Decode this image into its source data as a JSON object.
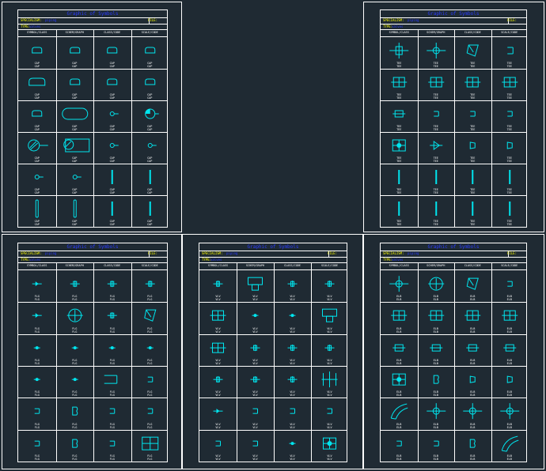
{
  "drawing": {
    "title": "Graphic of Symbols",
    "spec_label": "SPECIALISM:",
    "spec_value": "piping",
    "file_label": "FILE:",
    "type_label": "TYPE:",
    "type_value": "valves",
    "headers": [
      "SYMBOL/CLASS",
      "SCHEM/GRAPH",
      "CLASS/CODE",
      "SCALE/CODE"
    ],
    "colors": {
      "symbol": "#00e5ee",
      "title": "#2a3cff",
      "label": "#ffff00",
      "frame": "#ffffff",
      "background": "#1f2a33"
    }
  },
  "sheets": [
    {
      "name": "sheet-1",
      "captions": [
        [
          "CAP\nCAP",
          "CAP\nCAP",
          "CAP\nCAP",
          "CAP\nCAP"
        ],
        [
          "CAP\nCAP",
          "CAP\nCAP",
          "CAP\nCAP",
          "CAP\nCAP"
        ],
        [
          "CAP\nCAP",
          "CAP\nCAP",
          "CAP\nCAP",
          "CAP\nCAP"
        ],
        [
          "CAP\nCAP",
          "CAP\nCAP",
          "CAP\nCAP",
          "CAP\nCAP"
        ],
        [
          "CAP\nCAP",
          "CAP\nCAP",
          "CAP\nCAP",
          "CAP\nCAP"
        ],
        [
          "CAP\nCAP",
          "CAP\nCAP",
          "CAP\nCAP",
          "CAP\nCAP"
        ]
      ],
      "symbols": [
        [
          "dome",
          "dome",
          "dome",
          "dome"
        ],
        [
          "dome-wide",
          "dome",
          "dome",
          "dome"
        ],
        [
          "dome",
          "capsule",
          "ball-pin",
          "ball-large"
        ],
        [
          "ball-hatch",
          "ball-hatch-box",
          "ball-pin",
          "ball-pin"
        ],
        [
          "ball-pin",
          "ball-pin",
          "vbar",
          "vbar"
        ],
        [
          "vbar-thick",
          "vbar-thick",
          "vbar",
          "vbar"
        ]
      ]
    },
    {
      "name": "sheet-2",
      "captions": [
        [
          "TEE\nTEE",
          "TEE\nTEE",
          "TEE\nTEE",
          "TEE\nTEE"
        ],
        [
          "TEE\nTEE",
          "TEE\nTEE",
          "TEE\nTEE",
          "TEE\nTEE"
        ],
        [
          "TEE\nTEE",
          "TEE\nTEE",
          "TEE\nTEE",
          "TEE\nTEE"
        ],
        [
          "TEE\nTEE",
          "TEE\nTEE",
          "TEE\nTEE",
          "TEE\nTEE"
        ],
        [
          "TEE\nTEE",
          "TEE\nTEE",
          "TEE\nTEE",
          "TEE\nTEE"
        ],
        [
          "TEE\nTEE",
          "TEE\nTEE",
          "TEE\nTEE",
          "TEE\nTEE"
        ]
      ],
      "symbols": [
        [
          "cross-big",
          "cross-ball",
          "skew",
          "bracket"
        ],
        [
          "box-split",
          "box-split",
          "box-split",
          "box-split"
        ],
        [
          "box-split-small",
          "bracket-small",
          "bracket-small",
          "bracket-small"
        ],
        [
          "box-x",
          "triangle",
          "trap",
          "trap"
        ],
        [
          "vbar",
          "vbar",
          "vbar",
          "vbar"
        ],
        [
          "vbar",
          "vbar",
          "vbar",
          "vbar"
        ]
      ]
    },
    {
      "name": "sheet-3",
      "captions": [
        [
          "FLG\nFLG",
          "FLG\nFLG",
          "FLG\nFLG",
          "FLG\nFLG"
        ],
        [
          "FLG\nFLG",
          "FLG\nFLG",
          "FLG\nFLG",
          "FLG\nFLG"
        ],
        [
          "FLG\nFLG",
          "FLG\nFLG",
          "FLG\nFLG",
          "FLG\nFLG"
        ],
        [
          "FLG\nFLG",
          "FLG\nFLG",
          "FLG\nFLG",
          "FLG\nFLG"
        ],
        [
          "FLG\nFLG",
          "FLG\nFLG",
          "FLG\nFLG",
          "FLG\nFLG"
        ],
        [
          "FLG\nFLG",
          "FLG\nFLG",
          "FLG\nFLG",
          "FLG\nFLG"
        ]
      ],
      "symbols": [
        [
          "arrow-pin",
          "cross-small",
          "cross-small",
          "cross-small"
        ],
        [
          "arrow-pin",
          "ball-cross",
          "cross-small",
          "skew"
        ],
        [
          "dot",
          "dot",
          "dot",
          "dot"
        ],
        [
          "dot",
          "dot",
          "pipe-bracket",
          "bracket-small"
        ],
        [
          "bracket-small",
          "b-shape",
          "bracket-small",
          "bracket-small"
        ],
        [
          "bracket-small",
          "b-shape",
          "bracket-small",
          "box-big"
        ]
      ]
    },
    {
      "name": "sheet-4",
      "captions": [
        [
          "VLV\nVLV",
          "VLV\nVLV",
          "VLV\nVLV",
          "VLV\nVLV"
        ],
        [
          "VLV\nVLV",
          "VLV\nVLV",
          "VLV\nVLV",
          "VLV\nVLV"
        ],
        [
          "VLV\nVLV",
          "VLV\nVLV",
          "VLV\nVLV",
          "VLV\nVLV"
        ],
        [
          "VLV\nVLV",
          "VLV\nVLV",
          "VLV\nVLV",
          "VLV\nVLV"
        ],
        [
          "VLV\nVLV",
          "VLV\nVLV",
          "VLV\nVLV",
          "VLV\nVLV"
        ],
        [
          "VLV\nVLV",
          "VLV\nVLV",
          "VLV\nVLV",
          "VLV\nVLV"
        ]
      ],
      "symbols": [
        [
          "cross-small",
          "box-tall",
          "cross-small",
          "cross-small"
        ],
        [
          "box-split",
          "dot",
          "dot",
          "box-tall"
        ],
        [
          "box-split",
          "cross-small",
          "cross-small",
          "cross-small"
        ],
        [
          "cross-small",
          "cross-small",
          "cross-small",
          "cross-tall"
        ],
        [
          "arrow-pin",
          "bracket-small",
          "bracket-small",
          "bracket-small"
        ],
        [
          "bracket-small",
          "bracket-small",
          "dot",
          "box-x"
        ]
      ]
    },
    {
      "name": "sheet-5",
      "captions": [
        [
          "ELB\nELB",
          "ELB\nELB",
          "ELB\nELB",
          "ELB\nELB"
        ],
        [
          "ELB\nELB",
          "ELB\nELB",
          "ELB\nELB",
          "ELB\nELB"
        ],
        [
          "ELB\nELB",
          "ELB\nELB",
          "ELB\nELB",
          "ELB\nELB"
        ],
        [
          "ELB\nELB",
          "ELB\nELB",
          "ELB\nELB",
          "ELB\nELB"
        ],
        [
          "ELB\nELB",
          "ELB\nELB",
          "ELB\nELB",
          "ELB\nELB"
        ],
        [
          "ELB\nELB",
          "ELB\nELB",
          "ELB\nELB",
          "ELB\nELB"
        ]
      ],
      "symbols": [
        [
          "cross-ball",
          "ball-cross",
          "skew",
          "bracket-small"
        ],
        [
          "box-split",
          "box-split",
          "box-split",
          "box-split"
        ],
        [
          "box-split-small",
          "box-split-small",
          "box-split-small",
          "box-split-small"
        ],
        [
          "box-x",
          "b-shape",
          "trap",
          "trap"
        ],
        [
          "elbow",
          "cross-ball",
          "cross-ball",
          "cross-ball"
        ],
        [
          "bracket-small",
          "bracket-small",
          "b-shape",
          "elbow"
        ]
      ]
    }
  ]
}
